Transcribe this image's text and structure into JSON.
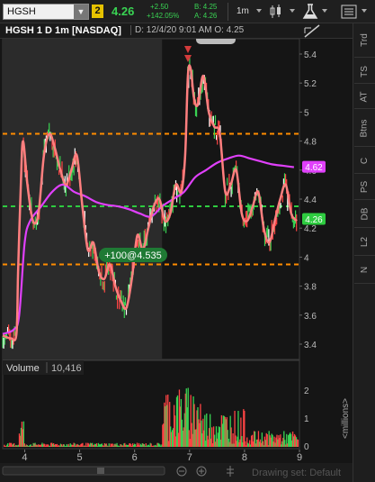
{
  "toolbar": {
    "symbol": "HGSH",
    "link_group": "2",
    "last_price": "4.26",
    "change_net": "+2.50",
    "change_pct": "+142.05%",
    "bid": "B: 4.25",
    "ask": "A: 4.26",
    "timeframe": "1m"
  },
  "header": {
    "title": "HGSH 1 D 1m [NASDAQ]",
    "bar_info": "D: 12/4/20 9:01 AM  O: 4.25"
  },
  "side_tabs": [
    "Trd",
    "TS",
    "AT",
    "Btns",
    "C",
    "PS",
    "DB",
    "L2",
    "N"
  ],
  "price_axis": {
    "ticks": [
      "5.4",
      "5.2",
      "5",
      "4.8",
      "4.6",
      "4.4",
      "4.2",
      "4",
      "3.8",
      "3.6",
      "3.4"
    ]
  },
  "markers": {
    "ma_price": "4.62",
    "last_price": "4.26",
    "order_label": "+100@4.535"
  },
  "volume": {
    "label": "Volume",
    "value": "10,416",
    "ticks": [
      "2",
      "1",
      "0"
    ],
    "unit": "<millions>"
  },
  "time_axis": {
    "ticks": [
      "4",
      "5",
      "6",
      "7",
      "8",
      "9"
    ]
  },
  "footer": {
    "drawing_set": "Drawing set: Default"
  },
  "colors": {
    "up": "#39d353",
    "down": "#ff4444",
    "smooth_line": "#ff7f7f",
    "moving_average": "#e040fb",
    "orange_level": "#ff8c00",
    "green_level": "#2ecc40",
    "premarket_bg": "#2b2b2b"
  },
  "chart_data": {
    "type": "line",
    "symbol": "HGSH",
    "interval": "1m",
    "x_range": [
      3.6,
      9
    ],
    "y_range": [
      3.35,
      5.55
    ],
    "price_line": {
      "x": [
        3.6,
        3.75,
        3.85,
        3.88,
        3.93,
        3.97,
        4.05,
        4.15,
        4.25,
        4.35,
        4.45,
        4.55,
        4.65,
        4.75,
        4.85,
        4.95,
        5.05,
        5.15,
        5.25,
        5.35,
        5.45,
        5.55,
        5.65,
        5.75,
        5.85,
        5.95,
        6.05,
        6.15,
        6.25,
        6.35,
        6.45,
        6.55,
        6.65,
        6.75,
        6.85,
        6.92,
        6.97,
        7.02,
        7.08,
        7.15,
        7.25,
        7.35,
        7.45,
        7.55,
        7.65,
        7.75,
        7.85,
        7.95,
        8.05,
        8.15,
        8.25,
        8.35,
        8.45,
        8.55,
        8.65,
        8.75,
        8.85,
        8.95
      ],
      "y": [
        3.46,
        3.44,
        3.47,
        3.9,
        4.5,
        4.8,
        4.5,
        4.25,
        4.3,
        4.7,
        4.85,
        4.75,
        4.6,
        4.5,
        4.6,
        4.7,
        4.35,
        4.05,
        4.1,
        3.9,
        3.85,
        3.95,
        3.8,
        3.7,
        3.65,
        3.85,
        4.15,
        4.05,
        4.2,
        4.35,
        4.4,
        4.25,
        4.3,
        4.5,
        4.45,
        4.7,
        5.25,
        5.3,
        5.1,
        5.05,
        5.25,
        5.0,
        4.9,
        4.85,
        4.45,
        4.5,
        4.6,
        4.3,
        4.25,
        4.35,
        4.45,
        4.2,
        4.1,
        4.25,
        4.4,
        4.5,
        4.3,
        4.25
      ]
    },
    "moving_average": {
      "x": [
        3.6,
        3.8,
        3.9,
        4.0,
        4.1,
        4.3,
        4.5,
        4.7,
        4.9,
        5.1,
        5.3,
        5.5,
        5.7,
        5.9,
        6.1,
        6.3,
        6.5,
        6.7,
        6.9,
        7.1,
        7.3,
        7.5,
        7.7,
        7.9,
        8.1,
        8.3,
        8.5,
        8.7,
        8.9
      ],
      "y": [
        3.47,
        3.5,
        3.6,
        4.1,
        4.25,
        4.35,
        4.45,
        4.5,
        4.45,
        4.42,
        4.38,
        4.36,
        4.35,
        4.33,
        4.3,
        4.28,
        4.35,
        4.4,
        4.45,
        4.55,
        4.6,
        4.65,
        4.68,
        4.7,
        4.68,
        4.66,
        4.64,
        4.63,
        4.62
      ]
    },
    "levels": [
      {
        "price": 4.85,
        "color": "orange"
      },
      {
        "price": 4.35,
        "color": "green"
      },
      {
        "price": 3.95,
        "color": "orange"
      }
    ],
    "premarket_end_x": 6.5
  }
}
